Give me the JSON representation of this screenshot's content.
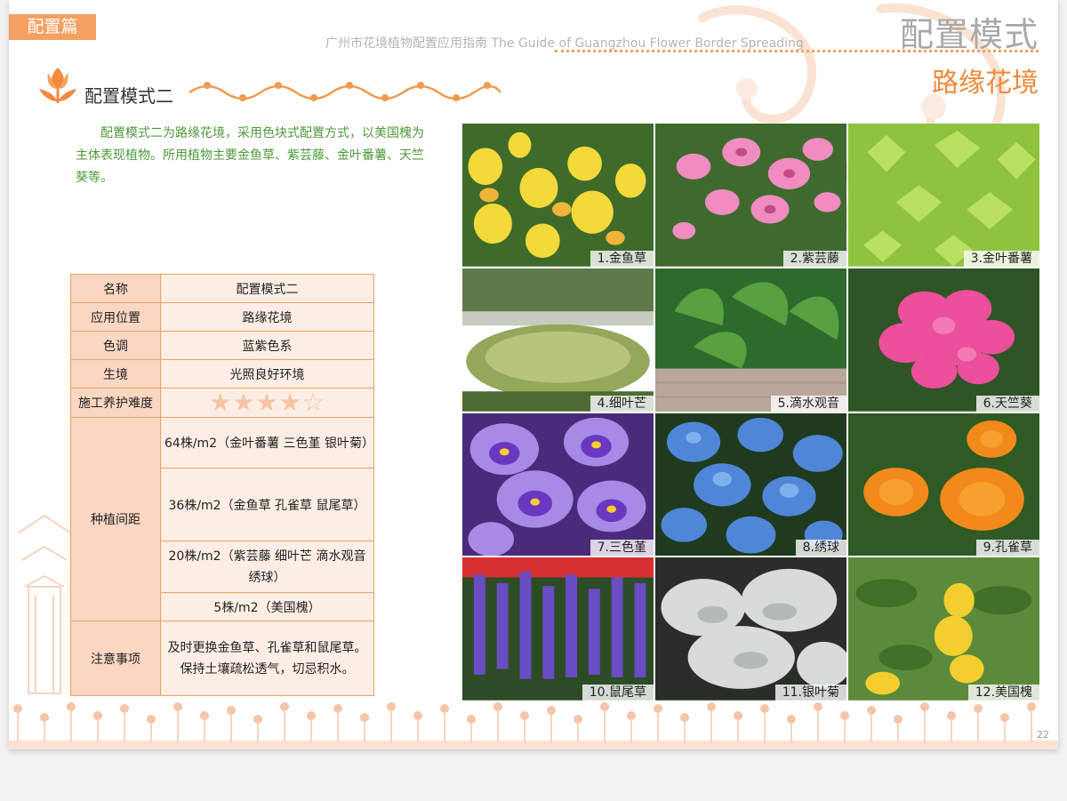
{
  "header": {
    "section_tag": "配置篇",
    "guide_title": "广州市花境植物配置应用指南 The Guide of Guangzhou Flower Border Spreading",
    "mode_title": "配置模式",
    "mode_subtitle": "路缘花境"
  },
  "section": {
    "title": "配置模式二",
    "description": "配置模式二为路缘花境，采用色块式配置方式，以美国槐为主体表现植物。所用植物主要金鱼草、紫芸藤、金叶番薯、天竺葵等。"
  },
  "table": {
    "name_label": "名称",
    "name_value": "配置模式二",
    "position_label": "应用位置",
    "position_value": "路缘花境",
    "tone_label": "色调",
    "tone_value": "蓝紫色系",
    "habitat_label": "生境",
    "habitat_value": "光照良好环境",
    "difficulty_label": "施工养护难度",
    "difficulty_stars_filled": "★★★★",
    "difficulty_stars_empty": "☆",
    "difficulty_rating": 4,
    "difficulty_max": 5,
    "spacing_label": "种植间距",
    "spacing_1": "64株/m2（金叶番薯 三色堇 银叶菊）",
    "spacing_2": "36株/m2（金鱼草 孔雀草 鼠尾草）",
    "spacing_3": "20株/m2（紫芸藤 细叶芒 滴水观音绣球）",
    "spacing_4": "5株/m2（美国槐）",
    "notes_label": "注意事项",
    "notes_value": "及时更换金鱼草、孔雀草和鼠尾草。保持土壤疏松透气，切忌积水。"
  },
  "photos": {
    "p1": "1.金鱼草",
    "p2": "2.紫芸藤",
    "p3": "3.金叶番薯",
    "p4": "4.细叶芒",
    "p5": "5.滴水观音",
    "p6": "6.天竺葵",
    "p7": "7.三色堇",
    "p8": "8.绣球",
    "p9": "9.孔雀草",
    "p10": "10.鼠尾草",
    "p11": "11.银叶菊",
    "p12": "12.美国槐"
  },
  "footer": {
    "page_number": "22"
  },
  "colors": {
    "accent": "#f4a060",
    "title_orange": "#ef8a3a",
    "desc_green": "#4f9a3a",
    "table_label_bg": "#f9d7c3",
    "table_value_bg": "#fdeee5"
  },
  "icons": {
    "section_icon": "tulip-icon",
    "divider": "vine-ornament-icon"
  }
}
